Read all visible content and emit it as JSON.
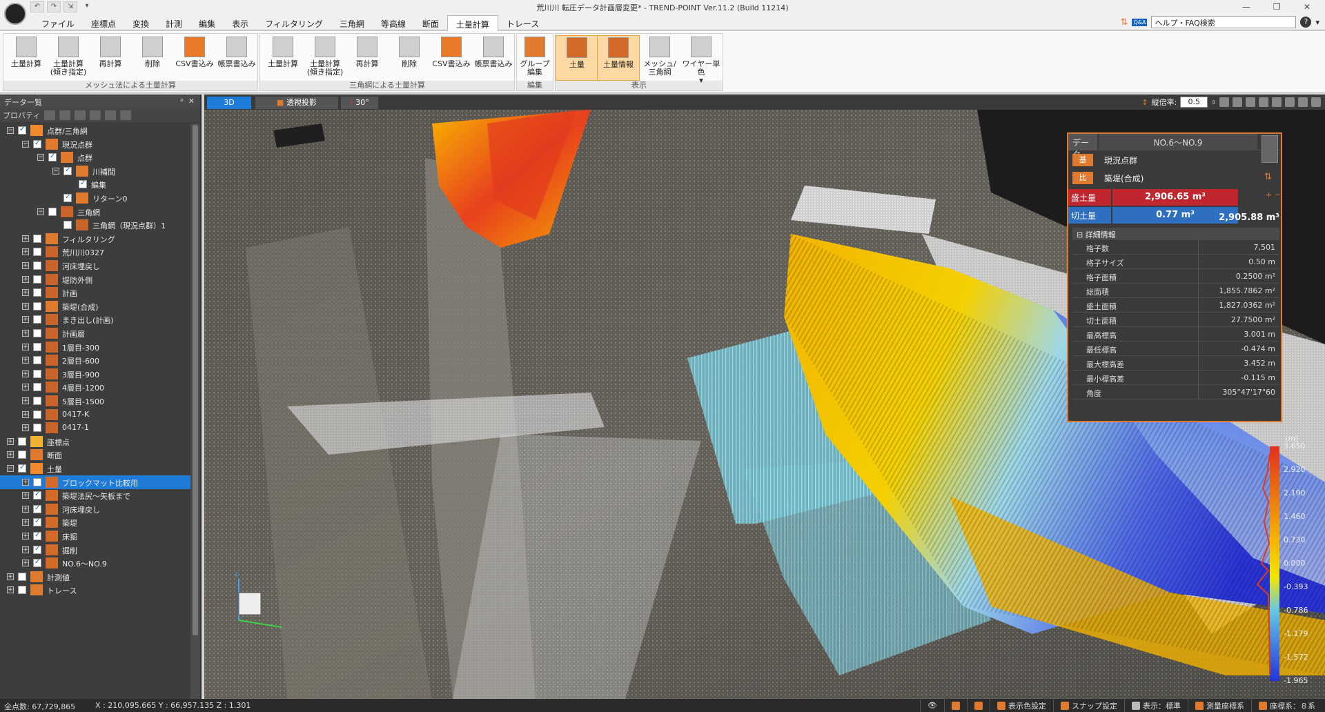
{
  "title": "荒川川 転圧データ計画層変更* - TREND-POINT Ver.11.2 (Build 11214)",
  "quick_access": [
    "↶",
    "↷",
    "⇲",
    "▾"
  ],
  "window_controls": [
    "—",
    "❐",
    "✕"
  ],
  "menu_tabs": [
    "ファイル",
    "座標点",
    "変換",
    "計測",
    "編集",
    "表示",
    "フィルタリング",
    "三角網",
    "等高線",
    "断面",
    "土量計算",
    "トレース"
  ],
  "active_tab": "土量計算",
  "help_search": "ヘルプ・FAQ検索",
  "help_q": "?",
  "ribbon": {
    "mesh_group_label": "メッシュ法による土量計算",
    "tri_group_label": "三角網による土量計算",
    "edit_group_label": "編集",
    "view_group_label": "表示",
    "mesh_buttons": [
      "土量計算",
      "土量計算\n(傾き指定)",
      "再計算",
      "削除",
      "CSV書込み",
      "帳票書込み"
    ],
    "tri_buttons": [
      "土量計算",
      "土量計算\n(傾き指定)",
      "再計算",
      "削除",
      "CSV書込み",
      "帳票書込み"
    ],
    "edit_buttons": [
      "グループ\n編集"
    ],
    "view_buttons": [
      "土量",
      "土量情報",
      "メッシュ/\n三角網",
      "ワイヤー単色\n▾"
    ]
  },
  "left_panel": {
    "title": "データ一覧",
    "pin": "ᵖ",
    "close": "✕",
    "toolbar_label": "プロパティ",
    "tree": [
      {
        "label": "点群/三角網",
        "level": 0,
        "exp": "−",
        "checked": true,
        "icon": "cloud"
      },
      {
        "label": "現況点群",
        "level": 1,
        "exp": "−",
        "checked": true,
        "icon": "base"
      },
      {
        "label": "点群",
        "level": 2,
        "exp": "−",
        "checked": true,
        "icon": "base"
      },
      {
        "label": "川補間",
        "level": 3,
        "exp": "−",
        "checked": true,
        "icon": "base"
      },
      {
        "label": "編集",
        "level": 4,
        "exp": "",
        "checked": true,
        "icon": ""
      },
      {
        "label": "リターン0",
        "level": 3,
        "exp": "",
        "checked": true,
        "icon": "base"
      },
      {
        "label": "三角網",
        "level": 2,
        "exp": "−",
        "checked": false,
        "icon": "tri"
      },
      {
        "label": "三角網（現況点群）1",
        "level": 3,
        "exp": "",
        "checked": false,
        "icon": "tri"
      },
      {
        "label": "フィルタリング",
        "level": 1,
        "exp": "+",
        "checked": false,
        "icon": "filter"
      },
      {
        "label": "荒川川0327",
        "level": 1,
        "exp": "+",
        "checked": false,
        "icon": "tri"
      },
      {
        "label": "河床埋戻し",
        "level": 1,
        "exp": "+",
        "checked": false,
        "icon": "tri"
      },
      {
        "label": "堤防外側",
        "level": 1,
        "exp": "+",
        "checked": false,
        "icon": "tri"
      },
      {
        "label": "計画",
        "level": 1,
        "exp": "+",
        "checked": false,
        "icon": "tri"
      },
      {
        "label": "築堤(合成)",
        "level": 1,
        "exp": "+",
        "checked": false,
        "icon": "ratio"
      },
      {
        "label": "まき出し(計画)",
        "level": 1,
        "exp": "+",
        "checked": false,
        "icon": "tri"
      },
      {
        "label": "計画層",
        "level": 1,
        "exp": "+",
        "checked": false,
        "icon": "tri"
      },
      {
        "label": "1層目-300",
        "level": 1,
        "exp": "+",
        "checked": false,
        "icon": "tri"
      },
      {
        "label": "2層目-600",
        "level": 1,
        "exp": "+",
        "checked": false,
        "icon": "tri"
      },
      {
        "label": "3層目-900",
        "level": 1,
        "exp": "+",
        "checked": false,
        "icon": "tri"
      },
      {
        "label": "4層目-1200",
        "level": 1,
        "exp": "+",
        "checked": false,
        "icon": "tri"
      },
      {
        "label": "5層目-1500",
        "level": 1,
        "exp": "+",
        "checked": false,
        "icon": "tri"
      },
      {
        "label": "0417-K",
        "level": 1,
        "exp": "+",
        "checked": false,
        "icon": "tri"
      },
      {
        "label": "0417-1",
        "level": 1,
        "exp": "+",
        "checked": false,
        "icon": "tri"
      },
      {
        "label": "座標点",
        "level": 0,
        "exp": "+",
        "checked": false,
        "icon": "points"
      },
      {
        "label": "断面",
        "level": 0,
        "exp": "+",
        "checked": false,
        "icon": "section"
      },
      {
        "label": "土量",
        "level": 0,
        "exp": "−",
        "checked": true,
        "icon": "volume"
      },
      {
        "label": "ブロックマット比較用",
        "level": 1,
        "exp": "+",
        "checked": false,
        "icon": "grid",
        "selected": true
      },
      {
        "label": "築堤法尻～矢板まで",
        "level": 1,
        "exp": "+",
        "checked": true,
        "icon": "grid"
      },
      {
        "label": "河床埋戻し",
        "level": 1,
        "exp": "+",
        "checked": true,
        "icon": "grid"
      },
      {
        "label": "築堤",
        "level": 1,
        "exp": "+",
        "checked": true,
        "icon": "grid"
      },
      {
        "label": "床掘",
        "level": 1,
        "exp": "+",
        "checked": true,
        "icon": "grid"
      },
      {
        "label": "掘削",
        "level": 1,
        "exp": "+",
        "checked": true,
        "icon": "grid"
      },
      {
        "label": "NO.6～NO.9",
        "level": 1,
        "exp": "+",
        "checked": true,
        "icon": "grid"
      },
      {
        "label": "計測値",
        "level": 0,
        "exp": "+",
        "checked": false,
        "icon": "measure"
      },
      {
        "label": "トレース",
        "level": 0,
        "exp": "+",
        "checked": false,
        "icon": "trace"
      }
    ]
  },
  "viewport": {
    "tab_3d": "3D",
    "tab_projection": "透視投影",
    "tab_angle": "30°",
    "scale_label": "縦倍率:",
    "scale_value": "0.5"
  },
  "info_panel": {
    "data_label": "データ",
    "data_name": "NO.6～NO.9",
    "base_badge": "基",
    "base_name": "現況点群",
    "ratio_badge": "比",
    "ratio_name": "築堤(合成)",
    "fill_label": "盛土量",
    "fill_value": "2,906.65 m³",
    "cut_label": "切土量",
    "cut_value": "0.77 m³",
    "net_value": "2,905.88 m³",
    "detail_header": "詳細情報",
    "details": [
      {
        "k": "格子数",
        "v": "7,501"
      },
      {
        "k": "格子サイズ",
        "v": "0.50 m"
      },
      {
        "k": "格子面積",
        "v": "0.2500 m²"
      },
      {
        "k": "総面積",
        "v": "1,855.7862 m²"
      },
      {
        "k": "盛土面積",
        "v": "1,827.0362 m²"
      },
      {
        "k": "切土面積",
        "v": "27.7500 m²"
      },
      {
        "k": "最高標高",
        "v": "3.001 m"
      },
      {
        "k": "最低標高",
        "v": "-0.474 m"
      },
      {
        "k": "最大標高差",
        "v": "3.452 m"
      },
      {
        "k": "最小標高差",
        "v": "-0.115 m"
      },
      {
        "k": "角度",
        "v": "305°47'17\"60"
      }
    ]
  },
  "legend": {
    "unit": "(m)",
    "ticks": [
      "3.650",
      "2.920",
      "2.190",
      "1.460",
      "0.730",
      "0.000",
      "-0.393",
      "-0.786",
      "-1.179",
      "-1.572",
      "-1.965"
    ],
    "colors": {
      "top": "#e0301e",
      "upper": "#f7b500",
      "zero": "#f2e600",
      "lower": "#63c8e6",
      "bottom": "#2333d8"
    }
  },
  "status": {
    "total_points": "全点数: 67,729,865",
    "coords": "X : 210,095.665  Y : 66,957.135  Z : 1.301",
    "display_color": "表示色設定",
    "snap": "スナップ設定",
    "display_mode": "表示：標準",
    "survey_coord": "測量座標系",
    "coord_sys": "座標系：８系"
  }
}
